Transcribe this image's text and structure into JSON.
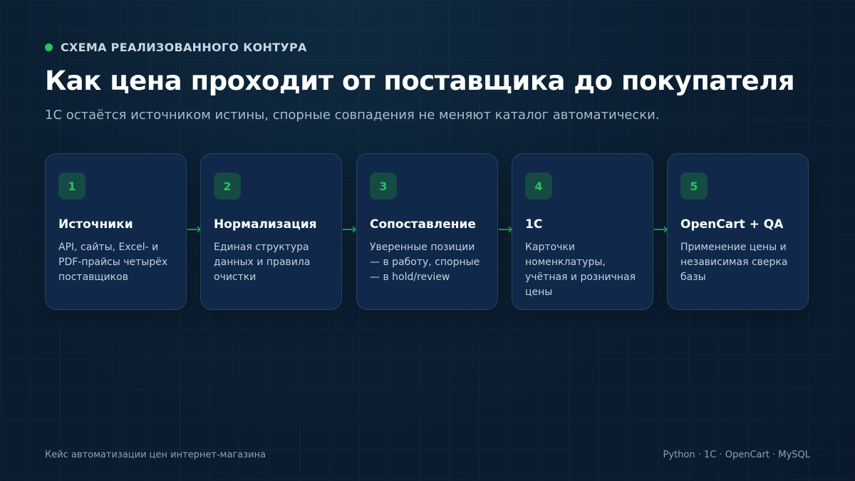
{
  "header": {
    "eyebrow": "СХЕМА РЕАЛИЗОВАННОГО КОНТУРА",
    "title": "Как цена проходит от поставщика до покупателя",
    "subtitle": "1С остаётся источником истины, спорные совпадения не меняют каталог автоматически."
  },
  "steps": [
    {
      "number": "1",
      "title": "Источники",
      "description": "API, сайты, Excel- и PDF-прайсы четырёх поставщиков"
    },
    {
      "number": "2",
      "title": "Нормализация",
      "description": "Единая структура данных и правила очистки"
    },
    {
      "number": "3",
      "title": "Сопоставление",
      "description": "Уверенные позиции — в работу, спорные — в hold/review"
    },
    {
      "number": "4",
      "title": "1С",
      "description": "Карточки номенклатуры, учётная и розничная цены"
    },
    {
      "number": "5",
      "title": "OpenCart + QA",
      "description": "Применение цены и независимая сверка базы"
    }
  ],
  "footer": {
    "left": "Кейс автоматизации цен интернет-магазина",
    "right": "Python · 1С · OpenCart · MySQL"
  },
  "colors": {
    "accent": "#22c55e",
    "background": "#0b1f33",
    "card": "#10294a"
  }
}
